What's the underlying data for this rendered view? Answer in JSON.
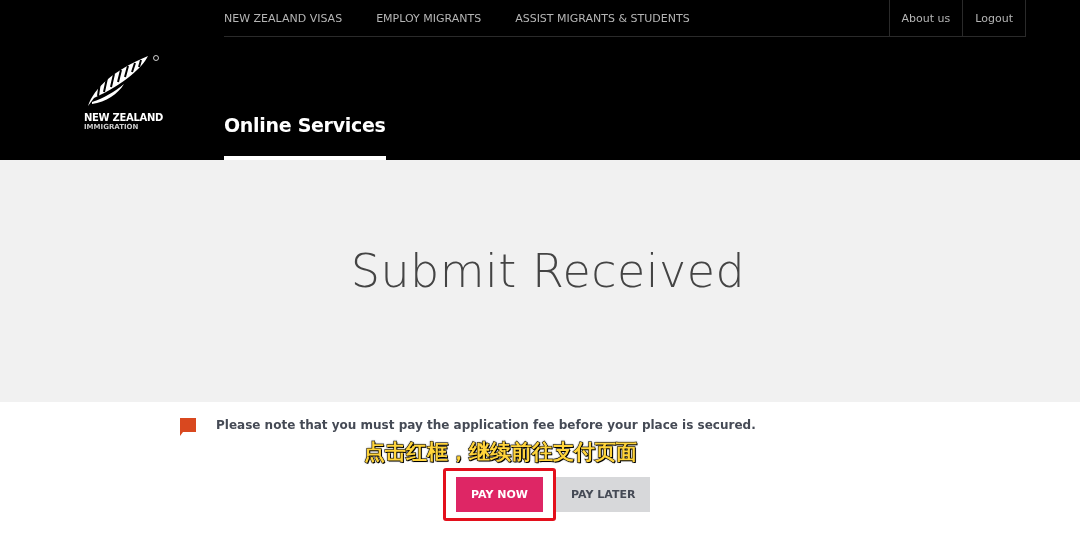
{
  "header": {
    "nav": [
      "NEW ZEALAND VISAS",
      "EMPLOY MIGRANTS",
      "ASSIST MIGRANTS & STUDENTS"
    ],
    "links": [
      "About us",
      "Logout"
    ],
    "logo": {
      "name": "NEW ZEALAND",
      "sub": "IMMIGRATION"
    },
    "section_title": "Online Services"
  },
  "banner": {
    "heading": "Submit Received"
  },
  "notice": "Please note that you must pay the application fee before your place is secured.",
  "caption": "点击红框，继续前往支付页面",
  "buttons": [
    {
      "label": "PAY NOW",
      "kind": "primary",
      "highlighted": true
    },
    {
      "label": "PAY LATER",
      "kind": "secondary",
      "highlighted": false
    }
  ]
}
